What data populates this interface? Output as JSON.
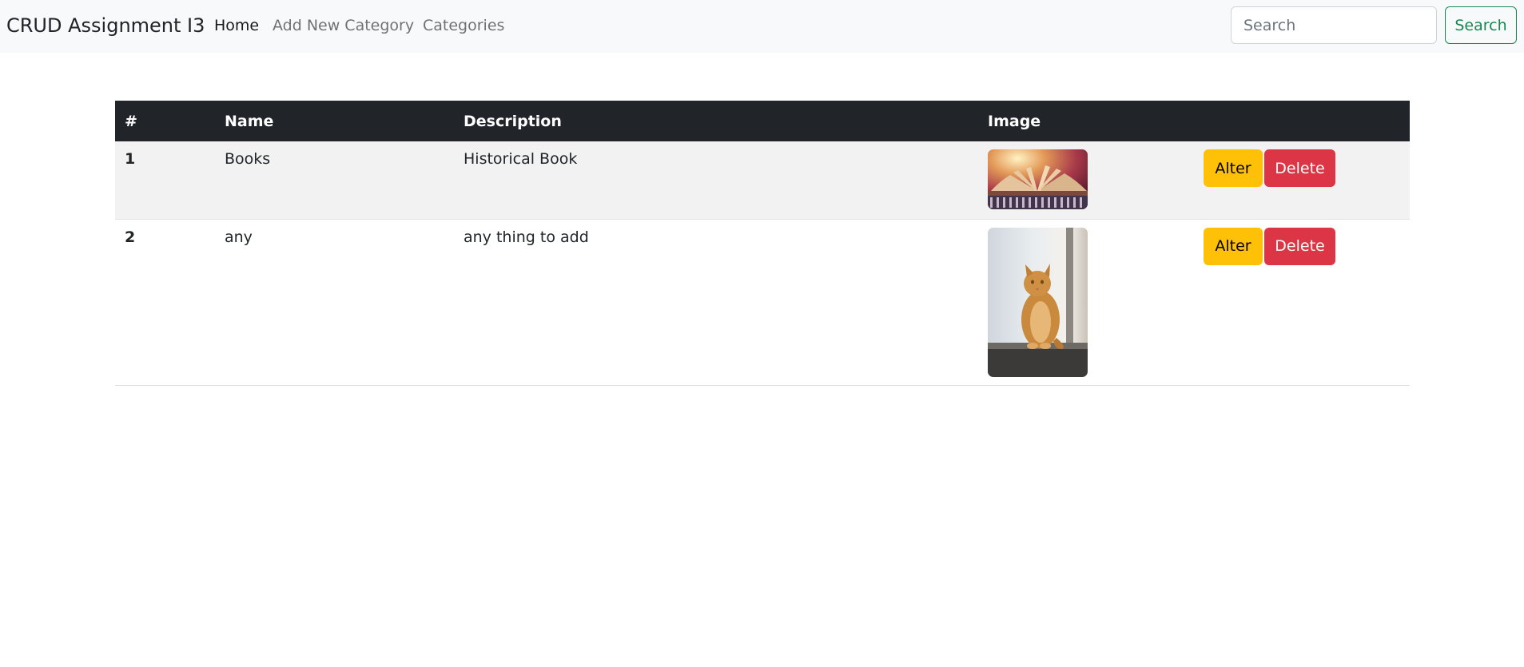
{
  "navbar": {
    "brand": "CRUD Assignment I3",
    "links": [
      {
        "label": "Home",
        "active": true
      },
      {
        "label": "Add New Category",
        "active": false
      },
      {
        "label": "Categories",
        "active": false
      }
    ],
    "search": {
      "placeholder": "Search",
      "value": "",
      "button_label": "Search"
    }
  },
  "table": {
    "headers": [
      "#",
      "Name",
      "Description",
      "Image",
      ""
    ],
    "rows": [
      {
        "index": "1",
        "name": "Books",
        "description": "Historical Book",
        "image": "book-photo",
        "alter_label": "Alter",
        "delete_label": "Delete"
      },
      {
        "index": "2",
        "name": "any",
        "description": "any thing to add",
        "image": "cat-photo",
        "alter_label": "Alter",
        "delete_label": "Delete"
      }
    ]
  },
  "colors": {
    "navbar_bg": "#f8f9fa",
    "table_head_bg": "#212529",
    "alter_button": "#ffc107",
    "delete_button": "#dc3545",
    "search_outline": "#198754"
  }
}
